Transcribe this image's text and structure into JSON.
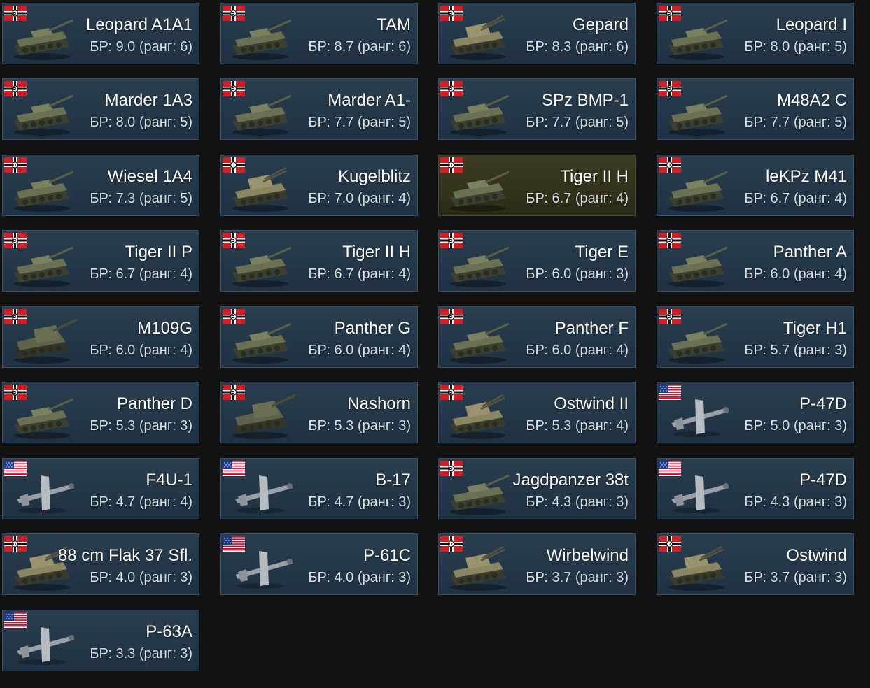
{
  "colors": {
    "background": "#121212",
    "card_bg": "#263a4b",
    "card_premium_bg": "#37341d",
    "text_primary": "#ffffff",
    "text_secondary": "#d6dde3"
  },
  "vehicles": [
    {
      "name": "Leopard A1A1",
      "br": "БР: 9.0 (ранг: 6)",
      "nation": "germany",
      "type": "tank",
      "premium": false
    },
    {
      "name": "TAM",
      "br": "БР: 8.7 (ранг: 6)",
      "nation": "germany",
      "type": "tank",
      "premium": false
    },
    {
      "name": "Gepard",
      "br": "БР: 8.3 (ранг: 6)",
      "nation": "germany",
      "type": "spaa",
      "premium": false
    },
    {
      "name": "Leopard I",
      "br": "БР: 8.0 (ранг: 5)",
      "nation": "germany",
      "type": "tank",
      "premium": false
    },
    {
      "name": "Marder 1A3",
      "br": "БР: 8.0 (ранг: 5)",
      "nation": "germany",
      "type": "tank",
      "premium": false
    },
    {
      "name": "Marder A1-",
      "br": "БР: 7.7 (ранг: 5)",
      "nation": "germany",
      "type": "tank",
      "premium": false
    },
    {
      "name": "SPz BMP-1",
      "br": "БР: 7.7 (ранг: 5)",
      "nation": "germany",
      "type": "tank",
      "premium": false
    },
    {
      "name": "M48A2 C",
      "br": "БР: 7.7 (ранг: 5)",
      "nation": "germany",
      "type": "tank",
      "premium": false
    },
    {
      "name": "Wiesel 1A4",
      "br": "БР: 7.3 (ранг: 5)",
      "nation": "germany",
      "type": "tank",
      "premium": false
    },
    {
      "name": "Kugelblitz",
      "br": "БР: 7.0 (ранг: 4)",
      "nation": "germany",
      "type": "spaa",
      "premium": false
    },
    {
      "name": "Tiger II H",
      "br": "БР: 6.7 (ранг: 4)",
      "nation": "germany",
      "type": "tank",
      "premium": true
    },
    {
      "name": "leKPz M41",
      "br": "БР: 6.7 (ранг: 4)",
      "nation": "germany",
      "type": "tank",
      "premium": false
    },
    {
      "name": "Tiger II P",
      "br": "БР: 6.7 (ранг: 4)",
      "nation": "germany",
      "type": "tank",
      "premium": false
    },
    {
      "name": "Tiger II H",
      "br": "БР: 6.7 (ранг: 4)",
      "nation": "germany",
      "type": "tank",
      "premium": false
    },
    {
      "name": "Tiger E",
      "br": "БР: 6.0 (ранг: 3)",
      "nation": "germany",
      "type": "tank",
      "premium": false
    },
    {
      "name": "Panther A",
      "br": "БР: 6.0 (ранг: 4)",
      "nation": "germany",
      "type": "tank",
      "premium": false
    },
    {
      "name": "M109G",
      "br": "БР: 6.0 (ранг: 4)",
      "nation": "germany",
      "type": "spg",
      "premium": false
    },
    {
      "name": "Panther G",
      "br": "БР: 6.0 (ранг: 4)",
      "nation": "germany",
      "type": "tank",
      "premium": false
    },
    {
      "name": "Panther F",
      "br": "БР: 6.0 (ранг: 4)",
      "nation": "germany",
      "type": "tank",
      "premium": false
    },
    {
      "name": "Tiger H1",
      "br": "БР: 5.7 (ранг: 3)",
      "nation": "germany",
      "type": "tank",
      "premium": false
    },
    {
      "name": "Panther D",
      "br": "БР: 5.3 (ранг: 3)",
      "nation": "germany",
      "type": "tank",
      "premium": false
    },
    {
      "name": "Nashorn",
      "br": "БР: 5.3 (ранг: 3)",
      "nation": "germany",
      "type": "spg",
      "premium": false
    },
    {
      "name": "Ostwind II",
      "br": "БР: 5.3 (ранг: 4)",
      "nation": "germany",
      "type": "spaa",
      "premium": false
    },
    {
      "name": "P-47D",
      "br": "БР: 5.0 (ранг: 3)",
      "nation": "usa",
      "type": "plane",
      "premium": false
    },
    {
      "name": "F4U-1",
      "br": "БР: 4.7 (ранг: 4)",
      "nation": "usa",
      "type": "plane",
      "premium": false
    },
    {
      "name": "B-17",
      "br": "БР: 4.7 (ранг: 3)",
      "nation": "usa",
      "type": "plane",
      "premium": false
    },
    {
      "name": "Jagdpanzer 38t",
      "br": "БР: 4.3 (ранг: 3)",
      "nation": "germany",
      "type": "tank",
      "premium": false
    },
    {
      "name": "P-47D",
      "br": "БР: 4.3 (ранг: 3)",
      "nation": "usa",
      "type": "plane",
      "premium": false
    },
    {
      "name": "88 cm Flak 37 Sfl.",
      "br": "БР: 4.0 (ранг: 3)",
      "nation": "germany",
      "type": "spaa",
      "premium": false
    },
    {
      "name": "P-61C",
      "br": "БР: 4.0 (ранг: 3)",
      "nation": "usa",
      "type": "plane",
      "premium": false
    },
    {
      "name": "Wirbelwind",
      "br": "БР: 3.7 (ранг: 3)",
      "nation": "germany",
      "type": "spaa",
      "premium": false
    },
    {
      "name": "Ostwind",
      "br": "БР: 3.7 (ранг: 3)",
      "nation": "germany",
      "type": "spaa",
      "premium": false
    },
    {
      "name": "P-63A",
      "br": "БР: 3.3 (ранг: 3)",
      "nation": "usa",
      "type": "plane",
      "premium": false
    }
  ]
}
